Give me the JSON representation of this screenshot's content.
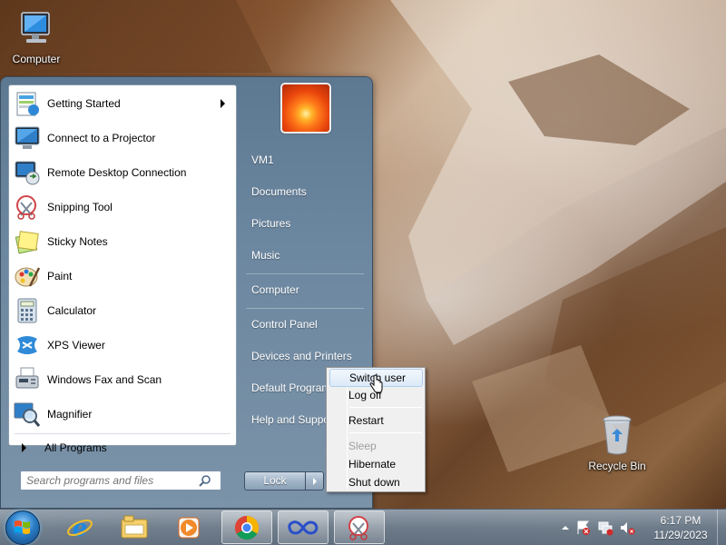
{
  "desktop": {
    "icons": [
      {
        "label": "Computer",
        "icon": "computer-icon"
      },
      {
        "label": "Recycle Bin",
        "icon": "recycle-bin-icon"
      }
    ]
  },
  "start_menu": {
    "programs": [
      {
        "label": "Getting Started",
        "icon": "getting-started-icon",
        "has_submenu": true
      },
      {
        "label": "Connect to a Projector",
        "icon": "projector-icon"
      },
      {
        "label": "Remote Desktop Connection",
        "icon": "remote-desktop-icon"
      },
      {
        "label": "Snipping Tool",
        "icon": "snipping-tool-icon"
      },
      {
        "label": "Sticky Notes",
        "icon": "sticky-notes-icon"
      },
      {
        "label": "Paint",
        "icon": "paint-icon"
      },
      {
        "label": "Calculator",
        "icon": "calculator-icon"
      },
      {
        "label": "XPS Viewer",
        "icon": "xps-viewer-icon"
      },
      {
        "label": "Windows Fax and Scan",
        "icon": "fax-scan-icon"
      },
      {
        "label": "Magnifier",
        "icon": "magnifier-icon"
      }
    ],
    "all_programs": "All Programs",
    "search_placeholder": "Search programs and files",
    "right_items": [
      "VM1",
      "Documents",
      "Pictures",
      "Music",
      "Computer",
      "Control Panel",
      "Devices and Printers",
      "Default Programs",
      "Help and Support"
    ],
    "lock_label": "Lock"
  },
  "power_menu": {
    "items": [
      {
        "label": "Switch user",
        "state": "highlighted"
      },
      {
        "label": "Log off",
        "state": "normal"
      },
      {
        "label": "Restart",
        "state": "normal"
      },
      {
        "label": "Sleep",
        "state": "disabled"
      },
      {
        "label": "Hibernate",
        "state": "normal"
      },
      {
        "label": "Shut down",
        "state": "normal"
      }
    ]
  },
  "taskbar": {
    "pinned": [
      "internet-explorer-icon",
      "windows-explorer-icon",
      "media-player-icon",
      "chrome-icon",
      "infinity-app-icon",
      "snipping-tool-icon"
    ],
    "clock": {
      "time": "6:17 PM",
      "date": "11/29/2023"
    }
  },
  "colors": {
    "accent": "#5d7891",
    "highlight": "#dce9f7"
  }
}
